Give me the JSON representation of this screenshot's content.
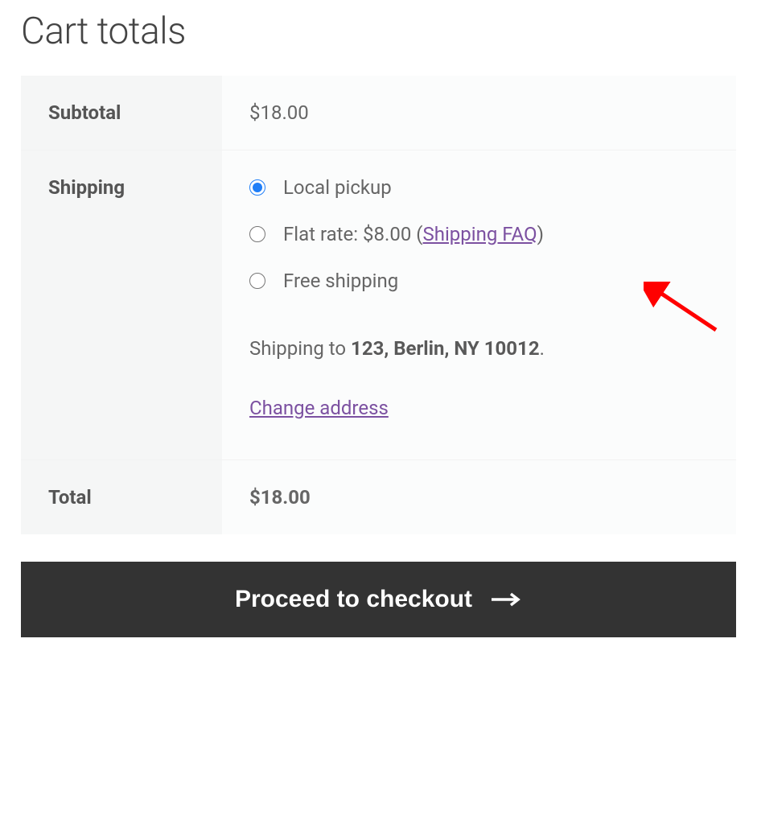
{
  "title": "Cart totals",
  "rows": {
    "subtotal_label": "Subtotal",
    "subtotal_value": "$18.00",
    "shipping_label": "Shipping",
    "total_label": "Total",
    "total_value": "$18.00"
  },
  "shipping": {
    "options": [
      {
        "label": "Local pickup",
        "checked": true
      },
      {
        "label_prefix": "Flat rate: ",
        "price": "$8.00",
        "paren_open": " (",
        "link_text": "Shipping FAQ",
        "paren_close": ")",
        "checked": false
      },
      {
        "label": "Free shipping",
        "checked": false
      }
    ],
    "destination_prefix": "Shipping to ",
    "destination_address": "123, Berlin, NY 10012",
    "destination_suffix": ".",
    "change_address": "Change address"
  },
  "checkout_button": "Proceed to checkout"
}
